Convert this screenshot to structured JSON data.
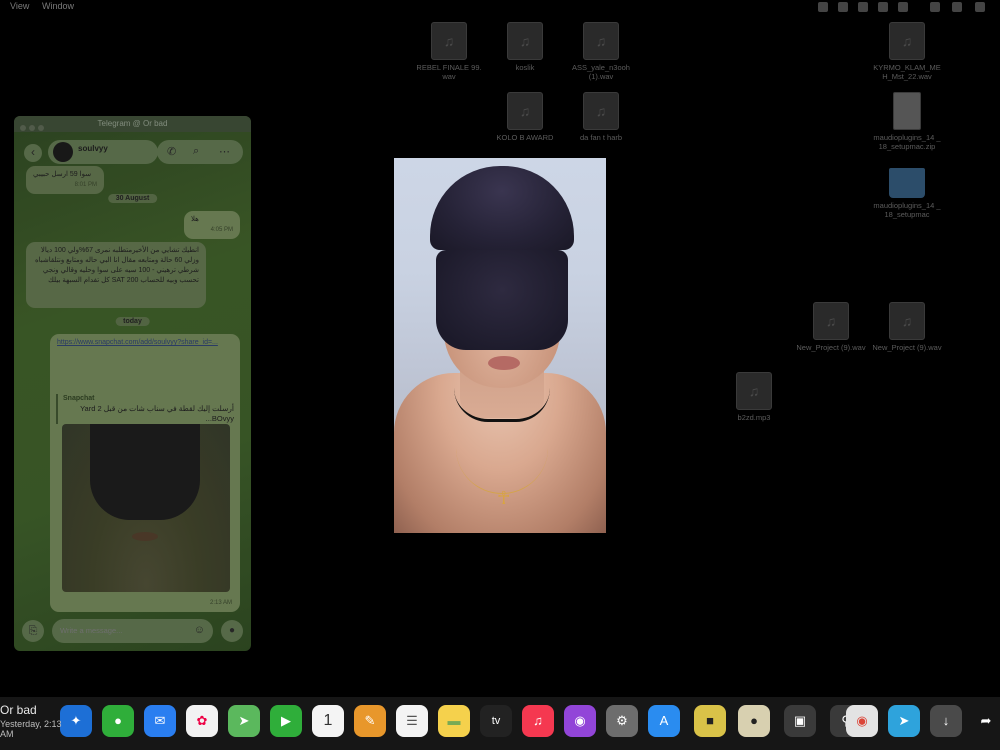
{
  "menubar": {
    "items": [
      "View",
      "Window"
    ]
  },
  "desktop_icons": [
    {
      "label": "REBEL FINALE 99.wav",
      "kind": "audio"
    },
    {
      "label": "koslik",
      "kind": "audio"
    },
    {
      "label": "ASS_yale_n3ooh (1).wav",
      "kind": "audio"
    },
    {
      "label": "KYRMO_KLAM_ME H_Mst_22.wav",
      "kind": "audio"
    },
    {
      "label": "KOLO B AWARD",
      "kind": "audio"
    },
    {
      "label": "da fan t harb",
      "kind": "audio"
    },
    {
      "label": "maudioplugins_14 _18_setupmac.zip",
      "kind": "doc"
    },
    {
      "label": "maudioplugins_14 _18_setupmac",
      "kind": "folder"
    },
    {
      "label": "New_Project (9).wav",
      "kind": "audio"
    },
    {
      "label": "New_Project (9).wav",
      "kind": "audio"
    },
    {
      "label": "b2zd.mp3",
      "kind": "audio"
    }
  ],
  "telegram": {
    "window_title": "Telegram @ Or bad",
    "contact_name": "soulvyy",
    "back_glyph": "‹",
    "call_glyph": "✆",
    "search_glyph": "⌕",
    "more_glyph": "⋯",
    "date_separator_1": "30 August",
    "date_separator_2": "today",
    "messages": [
      {
        "text": "سوا 59 ارسل حبيبي",
        "time": "8:01 PM",
        "dir": "in"
      },
      {
        "text": "هلا",
        "time": "4:05 PM",
        "dir": "out"
      },
      {
        "text": "انطيك تشايي من الأخيرمتطلبه نمرى 67%ولي 100 ديالا وزلي 60 حالة ومتابعه مقال انا البي حاله ومتابع ونتلقاشباه شرطي ترهيني - 100 سيه على سوا وحليه وقالي ونجي تحسب وبيه للحساب 200 SAT كل تفدام السبهة بيلك",
        "time": "",
        "dir": "in"
      },
      {
        "text": "https://www.snapchat.com/add/soulvyy?share_id=...",
        "time": "2:13 AM",
        "dir": "out"
      }
    ],
    "link_preview": {
      "source": "Snapchat",
      "description": "أرسلت إليك لقطة في سناب شات من قبل 2 Yard ...BOvyy"
    },
    "input_placeholder": "Write a message...",
    "attach_glyph": "⎘",
    "emoji_glyph": "☺",
    "mic_glyph": "⬤"
  },
  "notification": {
    "title": "Or bad",
    "subtitle": "Yesterday, 2:13 AM"
  },
  "dock": {
    "calendar_day": "1",
    "apple_tv": "tv",
    "music_glyph": "♫",
    "icons": [
      "safari",
      "messages",
      "mail",
      "photos",
      "maps",
      "facetime",
      "calendar",
      "pages",
      "reminders",
      "notes",
      "apple-tv",
      "music",
      "podcasts",
      "system-prefs",
      "app-store",
      "other",
      "chrome",
      "telegram",
      "downloads"
    ]
  },
  "colors": {
    "telegram_bg": "#3c5a27",
    "bubble_in": "#5c6e4a",
    "bubble_out": "#6c7f55",
    "dock_bg": "#282828"
  }
}
